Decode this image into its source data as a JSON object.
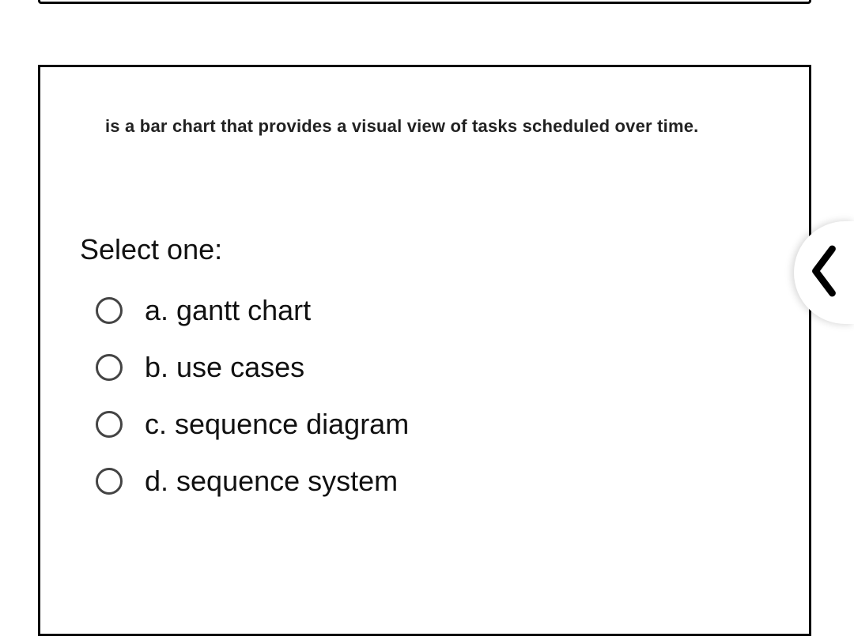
{
  "question": {
    "text": "is a bar chart that provides a visual view of tasks scheduled over time.",
    "prompt": "Select one:",
    "options": [
      {
        "label": "a. gantt chart"
      },
      {
        "label": "b. use cases"
      },
      {
        "label": "c. sequence diagram"
      },
      {
        "label": "d. sequence system"
      }
    ]
  }
}
